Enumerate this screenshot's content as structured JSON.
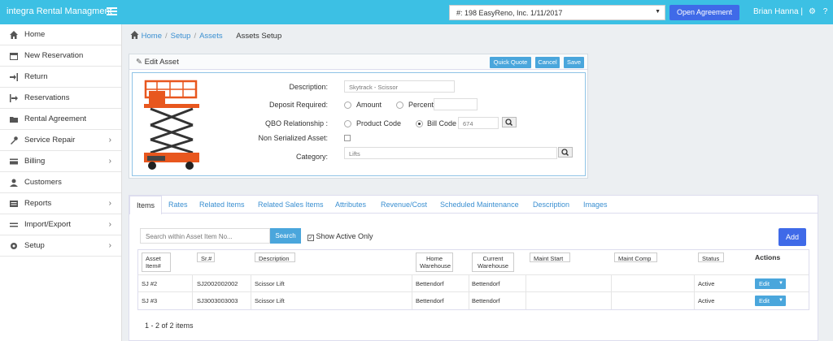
{
  "app": {
    "brand": "integra Rental Managment",
    "agreement_selected": "#: 198 EasyReno, Inc. 1/11/2017",
    "open_agreement": "Open Agreement",
    "user": "Brian Hanna |"
  },
  "sidebar": {
    "items": [
      {
        "label": "Home",
        "icon": "home-icon",
        "arrow": ""
      },
      {
        "label": "New Reservation",
        "icon": "calendar-icon",
        "arrow": ""
      },
      {
        "label": "Return",
        "icon": "sign-in-icon",
        "arrow": ""
      },
      {
        "label": "Reservations",
        "icon": "sign-out-icon",
        "arrow": ""
      },
      {
        "label": "Rental Agreement",
        "icon": "folder-open-icon",
        "arrow": ""
      },
      {
        "label": "Service Repair",
        "icon": "wrench-icon",
        "arrow": "›"
      },
      {
        "label": "Billing",
        "icon": "credit-card-icon",
        "arrow": "›"
      },
      {
        "label": "Customers",
        "icon": "user-icon",
        "arrow": ""
      },
      {
        "label": "Reports",
        "icon": "report-icon",
        "arrow": "›"
      },
      {
        "label": "Import/Export",
        "icon": "exchange-icon",
        "arrow": "›"
      },
      {
        "label": "Setup",
        "icon": "gear-icon",
        "arrow": "›"
      }
    ]
  },
  "breadcrumb": {
    "home": "Home",
    "setup": "Setup",
    "assets": "Assets",
    "current": "Assets Setup"
  },
  "edit_asset": {
    "title": "Edit Asset",
    "buttons": {
      "quick_quote": "Quick Quote",
      "cancel": "Cancel",
      "save": "Save"
    },
    "fields": {
      "description_label": "Description:",
      "description_value": "Skytrack - Scissor",
      "deposit_label": "Deposit Required:",
      "deposit_amount": "Amount",
      "deposit_percent": "Percent",
      "qbo_label": "QBO Relationship :",
      "qbo_product_code": "Product Code",
      "qbo_bill_code": "Bill Code",
      "bill_code_value": "674",
      "non_serialized_label": "Non Serialized Asset:",
      "category_label": "Category:",
      "category_value": "Lifts"
    }
  },
  "tabs": [
    "Items",
    "Rates",
    "Related Items",
    "Related Sales Items",
    "Attributes",
    "Revenue/Cost",
    "Scheduled Maintenance",
    "Description",
    "Images"
  ],
  "items_grid": {
    "search_placeholder": "Search within Asset Item No...",
    "search_button": "Search",
    "show_active_only": "Show Active Only",
    "add_button": "Add",
    "columns": [
      "Asset Item#",
      "Sr.#",
      "Description",
      "Home Warehouse",
      "Current Warehouse",
      "Maint Start",
      "Maint Comp",
      "Status",
      "Actions"
    ],
    "rows": [
      {
        "item": "SJ #2",
        "sr": "SJ2002002002",
        "description": "Scissor Lift",
        "home": "Bettendorf",
        "current": "Bettendorf",
        "maint_start": "",
        "maint_comp": "",
        "status": "Active",
        "action": "Edit"
      },
      {
        "item": "SJ #3",
        "sr": "SJ3003003003",
        "description": "Scissor Lift",
        "home": "Bettendorf",
        "current": "Bettendorf",
        "maint_start": "",
        "maint_comp": "",
        "status": "Active",
        "action": "Edit"
      }
    ],
    "pager": "1 - 2 of 2 items"
  }
}
